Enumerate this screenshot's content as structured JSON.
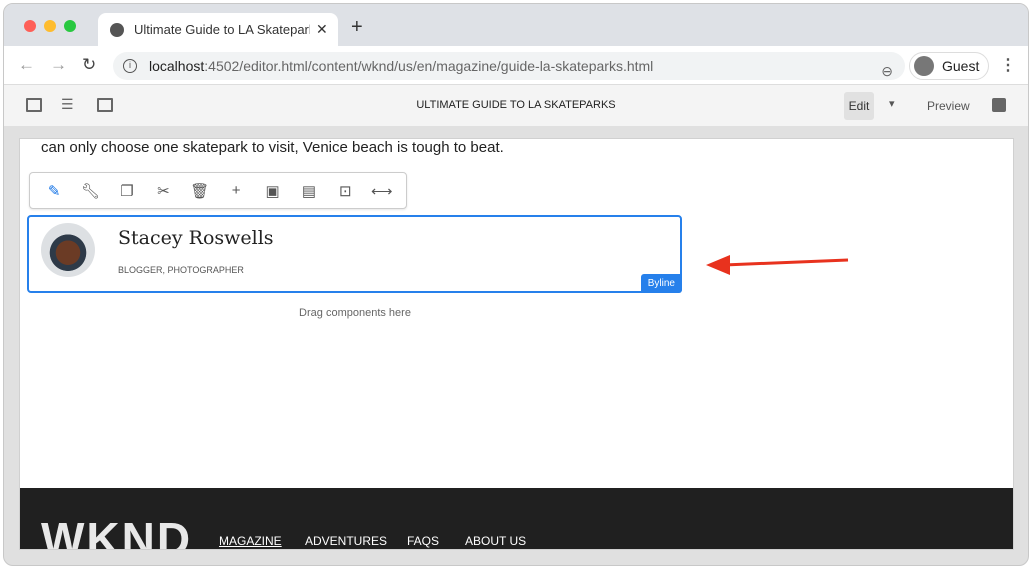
{
  "browser": {
    "tab_title": "Ultimate Guide to LA Skateparks",
    "url_host": "localhost",
    "url_path": ":4502/editor.html/content/wknd/us/en/magazine/guide-la-skateparks.html",
    "profile": "Guest"
  },
  "editor": {
    "page_title": "ULTIMATE GUIDE TO LA SKATEPARKS",
    "mode": "Edit",
    "preview": "Preview"
  },
  "content": {
    "paragraph": "can only choose one skatepark to visit, Venice beach is tough to beat.",
    "byline": {
      "name": "Stacey Roswells",
      "role": "BLOGGER, PHOTOGRAPHER",
      "badge": "Byline"
    },
    "drag_hint": "Drag components here"
  },
  "component_toolbar": [
    "edit-icon",
    "configure-icon",
    "copy-icon",
    "cut-icon",
    "delete-icon",
    "insert-icon",
    "group-icon",
    "layout-icon",
    "parent-icon",
    "resize-icon"
  ],
  "footer": {
    "logo": "WKND",
    "links": [
      "MAGAZINE",
      "ADVENTURES",
      "FAQS",
      "ABOUT US"
    ]
  },
  "colors": {
    "accent": "#2680eb",
    "arrow": "#e8321e"
  }
}
